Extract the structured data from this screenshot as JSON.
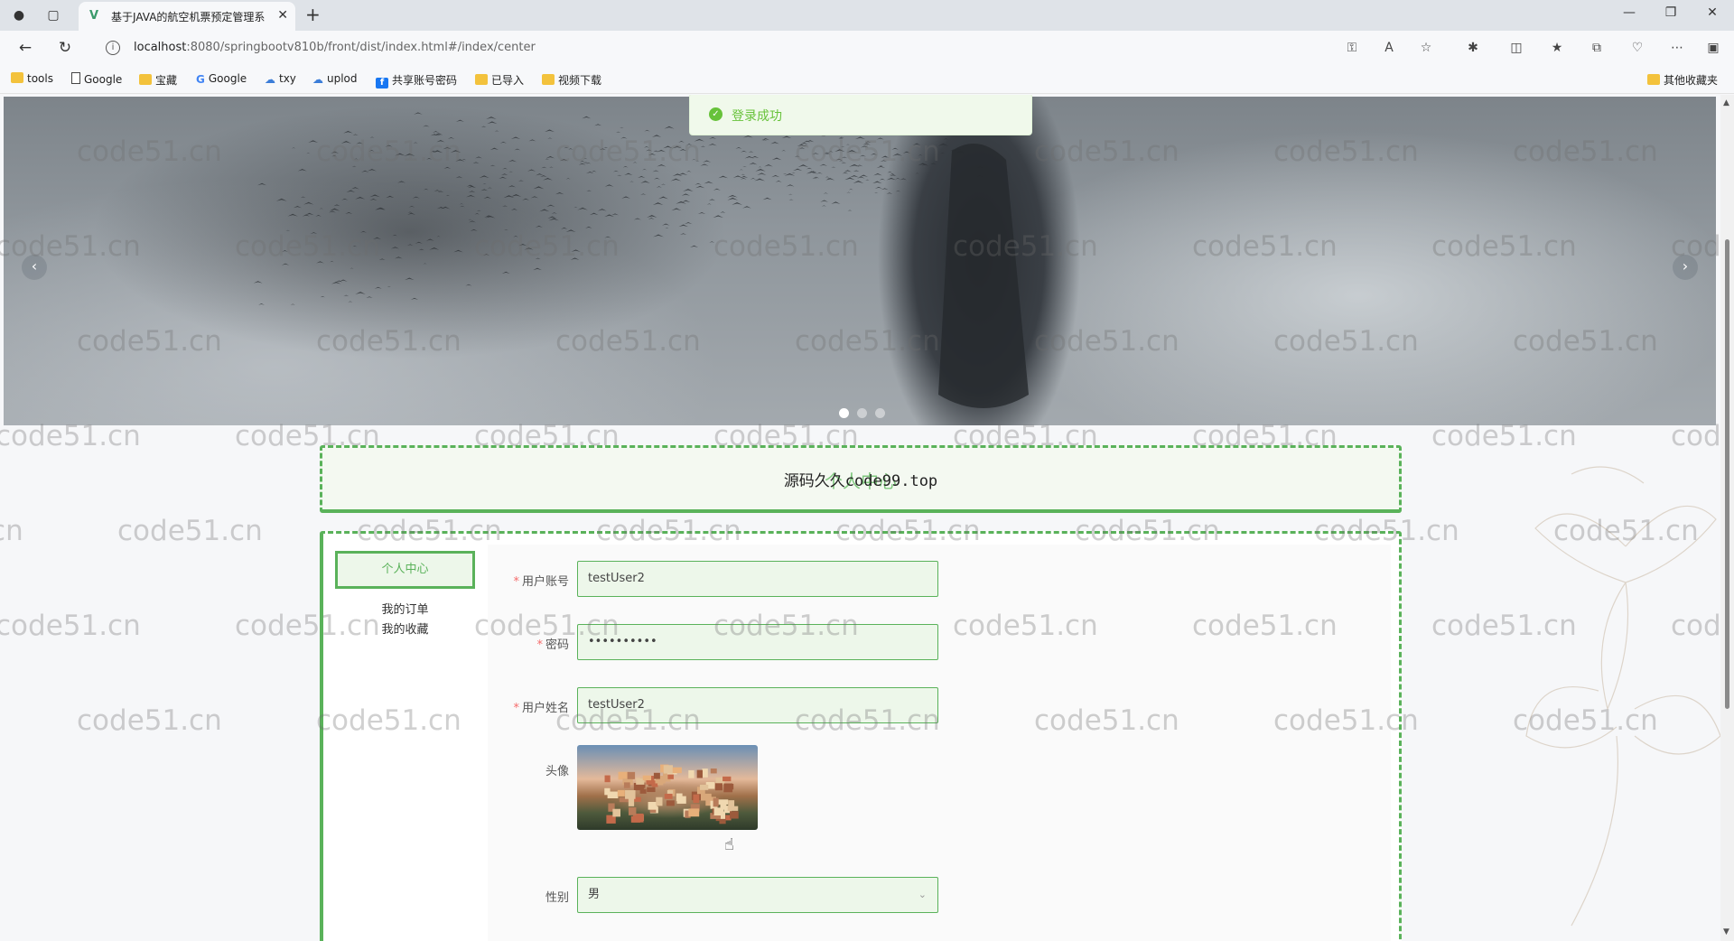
{
  "browser": {
    "tab_title": "基于JAVA的航空机票预定管理系",
    "url_host": "localhost",
    "url_rest": ":8080/springbootv810b/front/dist/index.html#/index/center",
    "bookmarks": [
      {
        "label": "tools",
        "icon": "folder-icon"
      },
      {
        "label": "Google",
        "icon": "page-icon"
      },
      {
        "label": "宝藏",
        "icon": "folder-icon"
      },
      {
        "label": "Google",
        "icon": "google-icon"
      },
      {
        "label": "txy",
        "icon": "cloud-icon"
      },
      {
        "label": "uplod",
        "icon": "cloud-icon"
      },
      {
        "label": "共享账号密码",
        "icon": "facebook-icon"
      },
      {
        "label": "已导入",
        "icon": "folder-icon"
      },
      {
        "label": "视频下载",
        "icon": "folder-icon"
      }
    ],
    "other_bookmarks": "其他收藏夹"
  },
  "toast": {
    "message": "登录成功"
  },
  "carousel": {
    "prev": "‹",
    "next": "›",
    "slides": 3,
    "active": 1
  },
  "page_title": {
    "text": "源码久久code99.top",
    "ghost": "个人中心"
  },
  "menu": {
    "active": "个人中心",
    "items": [
      "我的订单",
      "我的收藏"
    ]
  },
  "form": {
    "account_label": "用户账号",
    "account_value": "testUser2",
    "password_label": "密码",
    "password_value": "••••••••••",
    "name_label": "用户姓名",
    "name_value": "testUser2",
    "avatar_label": "头像",
    "gender_label": "性别",
    "gender_value": "男"
  },
  "watermark": "code51.cn",
  "colors": {
    "accent": "#5ab25a",
    "success": "#67c23a"
  }
}
